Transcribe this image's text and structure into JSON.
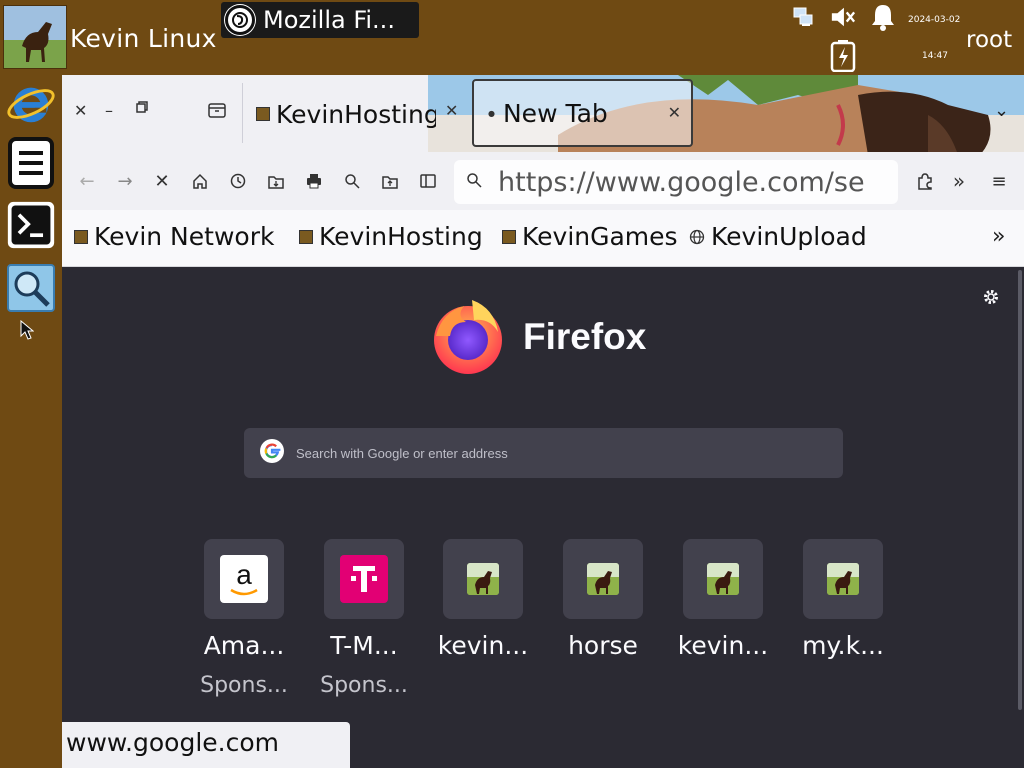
{
  "desktop": {
    "user_label": "Kevin Linux",
    "root_label": "root",
    "clock_date": "2024-03-02",
    "clock_time": "14:47",
    "taskbar_window_title": "Mozilla Fi..."
  },
  "browser": {
    "tabs": [
      {
        "label": "KevinHosting",
        "active": false
      },
      {
        "label": "New Tab",
        "active": true
      }
    ],
    "url": "https://www.google.com/se",
    "bookmarks": [
      {
        "label": "Kevin Network",
        "icon": "horse-favicon"
      },
      {
        "label": "KevinHosting",
        "icon": "horse-favicon"
      },
      {
        "label": "KevinGames",
        "icon": "horse-favicon"
      },
      {
        "label": "KevinUpload",
        "icon": "globe-icon"
      }
    ],
    "status_url": "www.google.com"
  },
  "newtab": {
    "wordmark": "Firefox",
    "search_placeholder": "Search with Google or enter address",
    "top_sites": [
      {
        "name": "Ama...",
        "sponsor": "Spons...",
        "icon": "amazon-icon"
      },
      {
        "name": "T-M...",
        "sponsor": "Spons...",
        "icon": "t-mobile-icon"
      },
      {
        "name": "kevin...",
        "sponsor": "",
        "icon": "horse-favicon"
      },
      {
        "name": "horse",
        "sponsor": "",
        "icon": "horse-favicon"
      },
      {
        "name": "kevin...",
        "sponsor": "",
        "icon": "horse-favicon"
      },
      {
        "name": "my.k...",
        "sponsor": "",
        "icon": "horse-favicon"
      }
    ]
  },
  "colors": {
    "panel": "#6f4a13",
    "newtab_bg": "#2b2a33",
    "tile_bg": "#42414d",
    "tmobile": "#e20074"
  }
}
